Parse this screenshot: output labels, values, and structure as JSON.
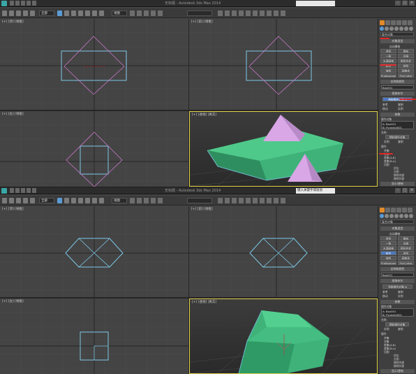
{
  "screens": [
    {
      "window_title": "无标题 - Autodesk 3ds Max 2014",
      "search_text": "",
      "menu": [
        "编辑(E)",
        "工具(T)",
        "组(G)",
        "视图(V)",
        "创建(C)",
        "修改器",
        "动画",
        "图形编辑器",
        "渲染(R)",
        "Civil View",
        "自定义(U)",
        "MAXScript(X)",
        "帮助(H)"
      ],
      "selection_filter": "全部",
      "view_dropdown": "视图",
      "viewports": {
        "top": "[+] [顶] [线框]",
        "front": "[+] [前] [线框]",
        "left": "[+] [左] [线框]",
        "persp": "[+] [透视] [真实]"
      },
      "panel": {
        "category": "复合对象",
        "rollout_object_type": "对象类型",
        "auto_grid": "自动栅格",
        "buttons": [
          [
            "变形",
            "散布"
          ],
          [
            "一致",
            "连接"
          ],
          [
            "水滴网格",
            "图形合并"
          ],
          [
            "布尔",
            "地形"
          ],
          [
            "放样",
            "网格化"
          ],
          [
            "ProBoolean",
            "ProCutter"
          ]
        ],
        "rollout_name_color": "名称和颜色",
        "name_value": "Box001",
        "rollout_pick": "拾取布尔",
        "pick_button": "拾取操作对象 B",
        "pick_options": [
          "参考",
          "复制",
          "移动",
          "实例"
        ],
        "rollout_params": "参数",
        "operands_label": "操作对象",
        "operands": [
          "A: Box001",
          "B: Pyramid001"
        ],
        "name_label": "名称:",
        "extract_button": "提取操作对象",
        "extract_options": [
          "实例",
          "复制"
        ],
        "operation_label": "操作",
        "operations": [
          "并集",
          "交集",
          "差集(A-B)",
          "差集(B-A)",
          "切割"
        ],
        "cut_options": [
          "优化",
          "分割",
          "移除内部",
          "移除外部"
        ],
        "rollout_display": "显示/更新",
        "selected_button": "布尔"
      }
    },
    {
      "window_title": "无标题 - Autodesk 3ds Max 2014",
      "search_text": "键入关键字或短语",
      "menu": [
        "编辑(E)",
        "工具(T)",
        "组(G)",
        "视图(V)",
        "创建(C)",
        "修改器",
        "动画",
        "图形编辑器",
        "渲染(R)",
        "Civil View",
        "自定义(U)",
        "MAXScript(X)",
        "帮助(H)"
      ],
      "selection_filter": "全部",
      "view_dropdown": "视图",
      "viewports": {
        "top": "[+] [顶] [线框]",
        "front": "[+] [前] [线框]",
        "left": "[+] [左] [线框]",
        "persp": "[+] [透视] [真实]"
      },
      "panel": {
        "category": "复合对象",
        "rollout_object_type": "对象类型",
        "auto_grid": "自动栅格",
        "buttons": [
          [
            "变形",
            "散布"
          ],
          [
            "一致",
            "连接"
          ],
          [
            "水滴网格",
            "图形合并"
          ],
          [
            "布尔",
            "地形"
          ],
          [
            "放样",
            "网格化"
          ],
          [
            "ProBoolean",
            "ProCutter"
          ]
        ],
        "rollout_name_color": "名称和颜色",
        "name_value": "Box001",
        "rollout_pick": "拾取布尔",
        "pick_button": "拾取操作对象 B",
        "pick_options": [
          "参考",
          "复制",
          "移动",
          "实例"
        ],
        "rollout_params": "参数",
        "operands_label": "操作对象",
        "operands": [
          "A: Box001",
          "B: Pyramid001"
        ],
        "name_label": "名称:",
        "extract_button": "提取操作对象",
        "extract_options": [
          "实例",
          "复制"
        ],
        "operation_label": "操作",
        "operations": [
          "并集",
          "交集",
          "差集(A-B)",
          "差集(B-A)",
          "切割"
        ],
        "cut_options": [
          "优化",
          "分割",
          "移除内部",
          "移除外部"
        ],
        "rollout_display": "显示/更新",
        "selected_button": "布尔"
      }
    }
  ],
  "colors": {
    "selection_wire": "#7ec8e8",
    "pyramid_wire": "#c678c8",
    "box_fill": "#3fb27a",
    "pyramid_fill": "#d9a6e6",
    "active_viewport_border": "#e6d34a",
    "annotation_red": "#e02828",
    "tab_active": "#e28a2a"
  }
}
